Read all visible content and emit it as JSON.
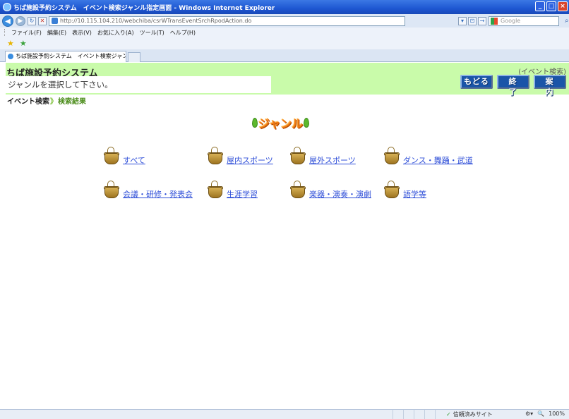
{
  "window": {
    "title": "ちば施設予約システム　イベント検索ジャンル指定画面 - Windows Internet Explorer",
    "controls": {
      "minimize": "_",
      "maximize": "□",
      "close": "×"
    }
  },
  "browser": {
    "address": "http://10.115.104.210/webchiba/csrWTransEventSrchRpodAction.do",
    "address_host": "10.115.104.210",
    "search_placeholder": "Google",
    "menu": [
      "ファイル(F)",
      "編集(E)",
      "表示(V)",
      "お気に入り(A)",
      "ツール(T)",
      "ヘルプ(H)"
    ],
    "tab_title": "ちば施設予約システム　イベント検索ジャンル指定画面"
  },
  "app": {
    "title": "ちば施設予約システム",
    "mode_label": "(イベント検索)",
    "instruction": "ジャンルを選択して下さい。",
    "buttons": {
      "back": "もどる",
      "exit": "終了",
      "guide": "案内"
    }
  },
  "breadcrumb": {
    "step1": "イベント検索",
    "separator": "》",
    "step2": "検索結果"
  },
  "genre_heading": "ジャンル",
  "genres": [
    "すべて",
    "屋内スポーツ",
    "屋外スポーツ",
    "ダンス・舞踊・武道",
    "会議・研修・発表会",
    "生涯学習",
    "楽器・演奏・演劇",
    "語学等"
  ],
  "status": {
    "zone": "信頼済みサイト",
    "zoom": "100%"
  }
}
